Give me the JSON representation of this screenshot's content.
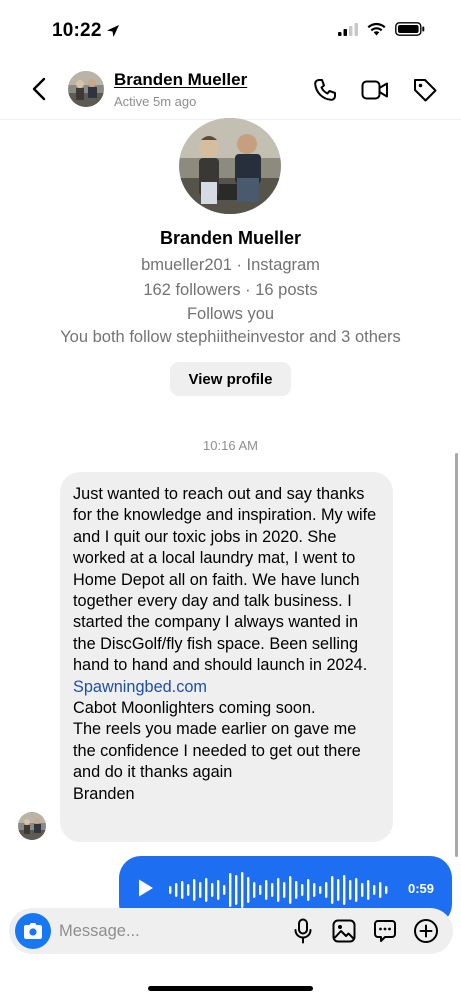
{
  "status_bar": {
    "time": "10:22",
    "location_arrow": "location-arrow-icon"
  },
  "header": {
    "back_icon": "chevron-left-icon",
    "name": "Branden Mueller",
    "status": "Active 5m ago",
    "actions": [
      "phone-icon",
      "video-icon",
      "tag-icon"
    ]
  },
  "profile": {
    "name": "Branden Mueller",
    "username_line": "bmueller201 · Instagram",
    "stats_line": "162 followers · 16 posts",
    "follows_line": "Follows you",
    "mutual_line": "You both follow stephiitheinvestor and 3 others",
    "view_button": "View profile"
  },
  "thread": {
    "timestamp": "10:16 AM",
    "message": {
      "text_before_link": "Just wanted to reach out and say thanks for the knowledge and inspiration.  My wife and I quit our toxic jobs in 2020. She worked at a local laundry mat, I went to Home Depot all on faith.  We have lunch together every day and talk business. I started the company I always wanted in the DiscGolf/fly fish space. Been selling hand to hand and should launch in 2024. ",
      "link": "Spawningbed.com",
      "text_after_link": "Cabot Moonlighters coming soon.\nThe reels you made earlier on gave me the confidence I needed to get out there and do it thanks again\nBranden"
    },
    "voice_message": {
      "duration": "0:59",
      "play_icon": "play-icon"
    }
  },
  "composer": {
    "placeholder": "Message...",
    "icons": [
      "camera-icon",
      "microphone-icon",
      "gallery-icon",
      "sticker-icon",
      "plus-circle-icon"
    ]
  },
  "colors": {
    "accent": "#1877f2",
    "voice_bubble": "#1d6ef0",
    "bubble_gray": "#efefef",
    "secondary_text": "#737373",
    "link": "#1e4fa8"
  }
}
